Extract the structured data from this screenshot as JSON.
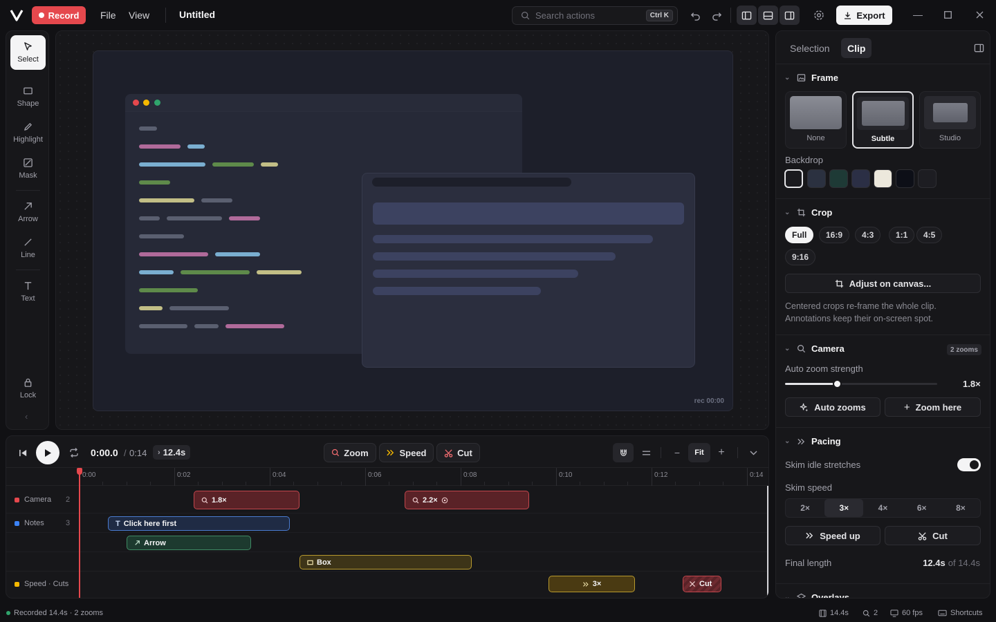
{
  "app": {
    "record_label": "Record",
    "menus": [
      "File",
      "View"
    ],
    "doc_title": "Untitled",
    "search_placeholder": "Search actions",
    "search_shortcut": "Ctrl K",
    "export_label": "Export"
  },
  "tools": [
    {
      "label": "Select",
      "icon": "cursor-icon",
      "active": true
    },
    {
      "label": "Shape",
      "icon": "rectangle-icon"
    },
    {
      "label": "Highlight",
      "icon": "pen-icon"
    },
    {
      "label": "Mask",
      "icon": "mask-icon"
    },
    {
      "label": "Arrow",
      "icon": "arrow-icon"
    },
    {
      "label": "Line",
      "icon": "line-icon"
    },
    {
      "label": "Text",
      "icon": "text-icon"
    },
    {
      "label": "Lock",
      "icon": "lock-icon"
    }
  ],
  "canvas": {
    "rec_timestamp": "rec 00:00"
  },
  "timeline": {
    "current_time": "0:00.0",
    "separator": "/",
    "total_time": "0:14",
    "final_length": "12.4s",
    "actions": [
      "Zoom",
      "Speed",
      "Cut"
    ],
    "fit_label": "Fit",
    "ticks": [
      "0:00",
      "0:02",
      "0:04",
      "0:06",
      "0:08",
      "0:10",
      "0:12",
      "0:14"
    ],
    "tracks": [
      {
        "name": "Camera",
        "count": "2",
        "color": "#e5484d"
      },
      {
        "name": "Notes",
        "count": "3",
        "color": "#3b82f6"
      },
      {
        "name": "Speed · Cuts",
        "count": "",
        "color": "#f5b800"
      }
    ],
    "clips": {
      "zoom1": "1.8×",
      "zoom2": "2.2×",
      "note1": "Click here first",
      "note2": "Arrow",
      "note3": "Box",
      "speed": "3×",
      "cut": "Cut"
    }
  },
  "panel": {
    "tabs": [
      "Selection",
      "Clip"
    ],
    "active_tab": "Clip",
    "frame": {
      "title": "Frame",
      "options": [
        "None",
        "Subtle",
        "Studio"
      ],
      "selected": "Subtle"
    },
    "backdrop": {
      "label": "Backdrop",
      "swatches": [
        "#1a1a1e",
        "#2b3140",
        "#1e3a36",
        "#2b2f45",
        "#ece8dc",
        "#0d0f17",
        "#1d1d22"
      ]
    },
    "crop": {
      "title": "Crop",
      "options": [
        "Full",
        "16:9",
        "4:3",
        "1:1",
        "4:5",
        "9:16"
      ],
      "selected": "Full",
      "adjust_label": "Adjust on canvas...",
      "note": "Centered crops re-frame the whole clip. Annotations keep their on-screen spot."
    },
    "camera": {
      "title": "Camera",
      "badge": "2 zooms",
      "strength_label": "Auto zoom strength",
      "strength_value": "1.8×",
      "strength_fraction": 0.34,
      "auto_zooms_label": "Auto zooms",
      "zoom_here_label": "Zoom here"
    },
    "pacing": {
      "title": "Pacing",
      "skim_idle_label": "Skim idle stretches",
      "skim_idle_on": true,
      "skim_speed_label": "Skim speed",
      "speeds": [
        "2×",
        "3×",
        "4×",
        "6×",
        "8×"
      ],
      "selected_speed": "3×",
      "speed_up_label": "Speed up",
      "cut_label": "Cut",
      "final_length_label": "Final length",
      "final_length_value": "12.4s",
      "final_length_of": "of 14.4s"
    },
    "overlays_title": "Overlays"
  },
  "status": {
    "recorded": "Recorded 14.4s · 2 zooms",
    "duration": "14.4s",
    "zooms": "2",
    "fps": "60 fps",
    "shortcuts": "Shortcuts"
  }
}
